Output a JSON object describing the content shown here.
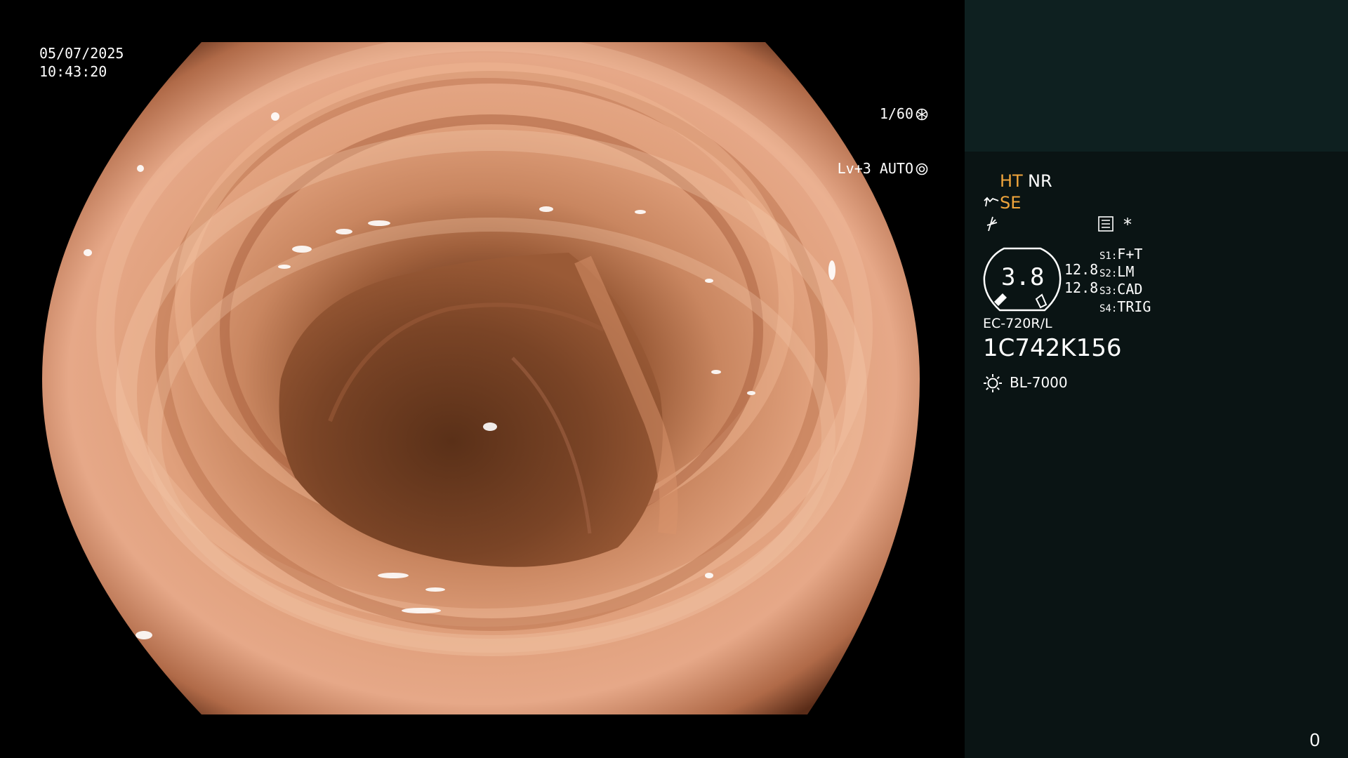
{
  "overlay": {
    "date": "05/07/2025",
    "time": "10:43:20",
    "shutter": "1/60",
    "level": "Lv+3 AUTO"
  },
  "panel": {
    "ht": "HT",
    "nr": "NR",
    "se": "SE",
    "gauge_value": "3.8",
    "left_values": [
      "12.8",
      "12.8"
    ],
    "switches": [
      {
        "key": "S1:",
        "label": "F+T"
      },
      {
        "key": "S2:",
        "label": "LM"
      },
      {
        "key": "S3:",
        "label": "CAD"
      },
      {
        "key": "S4:",
        "label": "TRIG"
      }
    ],
    "scope_model": "EC-720R/L",
    "scope_serial": "1C742K156",
    "light_source": "BL-7000",
    "asterisk": "*"
  },
  "frame_counter": "0",
  "icons": [
    "shutter-icon",
    "auto-iris-icon",
    "enhance-icon",
    "flash-icon",
    "menu-icon",
    "gauge-icon",
    "lamp-icon"
  ],
  "colors": {
    "accent": "#f0a53c",
    "panel_bg": "#0a1414",
    "panel_top": "#0e2020"
  }
}
